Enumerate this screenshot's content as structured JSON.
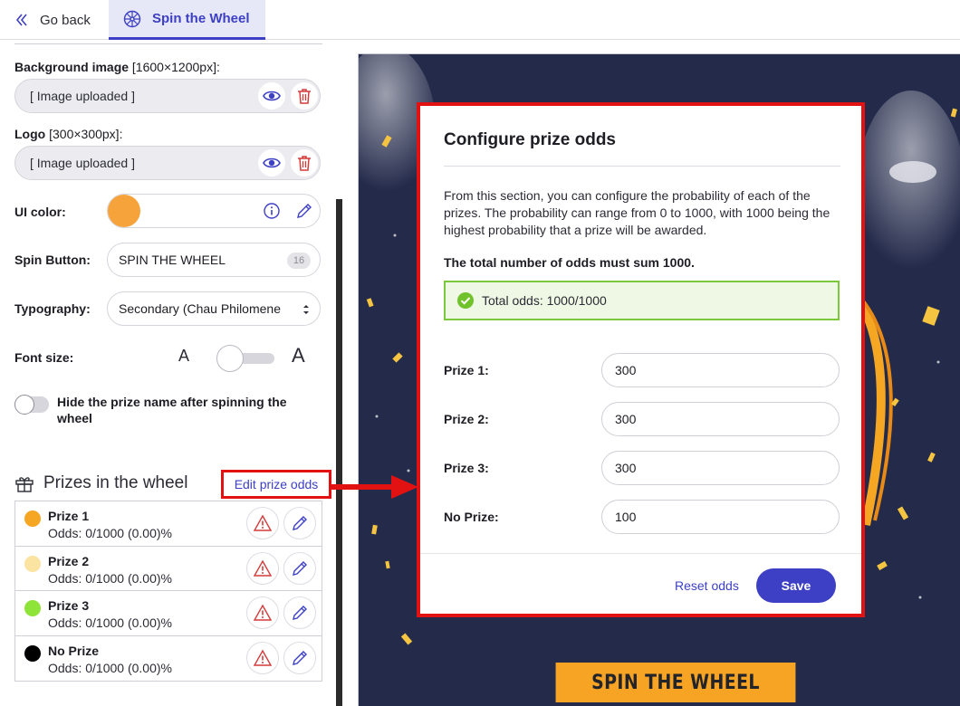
{
  "tabs": {
    "back_label": "Go back",
    "active_label": "Spin the Wheel"
  },
  "settings": {
    "background_image": {
      "label": "Background image",
      "size": "[1600×1200px]:",
      "value": "[ Image uploaded ]"
    },
    "logo": {
      "label": "Logo",
      "size": "[300×300px]:",
      "value": "[ Image uploaded ]"
    },
    "ui_color": {
      "label": "UI color:",
      "value": "#f5a33a"
    },
    "spin_button": {
      "label": "Spin Button:",
      "value": "SPIN THE WHEEL",
      "counter": "16"
    },
    "typography": {
      "label": "Typography:",
      "value": "Secondary (Chau Philomene"
    },
    "font_size": {
      "label": "Font size:",
      "small_glyph": "A",
      "large_glyph": "A"
    },
    "hide_prize_name": {
      "label": "Hide the prize name after spinning the wheel"
    }
  },
  "prizes": {
    "title": "Prizes in the wheel",
    "edit_odds_label": "Edit prize odds",
    "items": [
      {
        "name": "Prize 1",
        "odds": "Odds: 0/1000 (0.00)%",
        "color": "#f5a623"
      },
      {
        "name": "Prize 2",
        "odds": "Odds: 0/1000 (0.00)%",
        "color": "#fbe3a1"
      },
      {
        "name": "Prize 3",
        "odds": "Odds: 0/1000 (0.00)%",
        "color": "#8fe43a"
      },
      {
        "name": "No Prize",
        "odds": "Odds: 0/1000 (0.00)%",
        "color": "#000000"
      }
    ]
  },
  "preview": {
    "spin_button_label": "SPIN THE WHEEL"
  },
  "modal": {
    "title": "Configure prize odds",
    "description": "From this section, you can configure the probability of each of the prizes. The probability can range from 0 to 1000, with 1000 being the highest probability that a prize will be awarded.",
    "note": "The total number of odds must sum 1000.",
    "total_label": "Total odds: 1000/1000",
    "rows": [
      {
        "label": "Prize 1:",
        "value": "300"
      },
      {
        "label": "Prize 2:",
        "value": "300"
      },
      {
        "label": "Prize 3:",
        "value": "300"
      },
      {
        "label": "No Prize:",
        "value": "100"
      }
    ],
    "reset_label": "Reset odds",
    "save_label": "Save"
  },
  "colors": {
    "accent": "#3d40c4",
    "highlight_border": "#e31212",
    "success": "#7bc93a",
    "preview_bg": "#232a4a",
    "spin_button_bg": "#f7a425"
  }
}
